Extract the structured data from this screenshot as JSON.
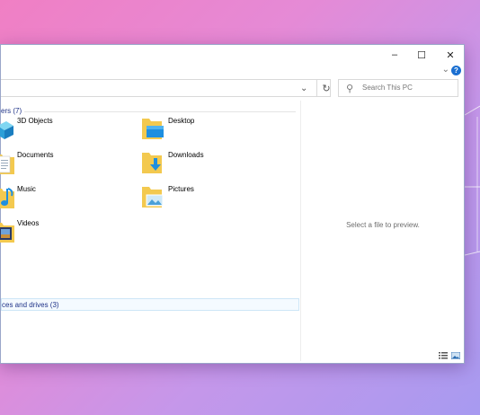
{
  "window": {
    "controls": {
      "minimize": "–",
      "maximize": "☐",
      "close": "✕"
    },
    "help": "?",
    "refresh": "↻",
    "address_dropdown": "⌄",
    "search_placeholder": "Search This PC"
  },
  "folders_group": {
    "header": "ers (7)",
    "items": [
      {
        "label": "3D Objects",
        "icon": "3d-objects-icon"
      },
      {
        "label": "Desktop",
        "icon": "desktop-folder-icon"
      },
      {
        "label": "Documents",
        "icon": "documents-folder-icon"
      },
      {
        "label": "Downloads",
        "icon": "downloads-folder-icon"
      },
      {
        "label": "Music",
        "icon": "music-folder-icon"
      },
      {
        "label": "Pictures",
        "icon": "pictures-folder-icon"
      },
      {
        "label": "Videos",
        "icon": "videos-folder-icon"
      }
    ]
  },
  "drives_group": {
    "header": "ces and drives (3)"
  },
  "preview": {
    "text": "Select a file to preview."
  },
  "colors": {
    "accent": "#1a6fd1",
    "group_header": "#1e3287"
  }
}
